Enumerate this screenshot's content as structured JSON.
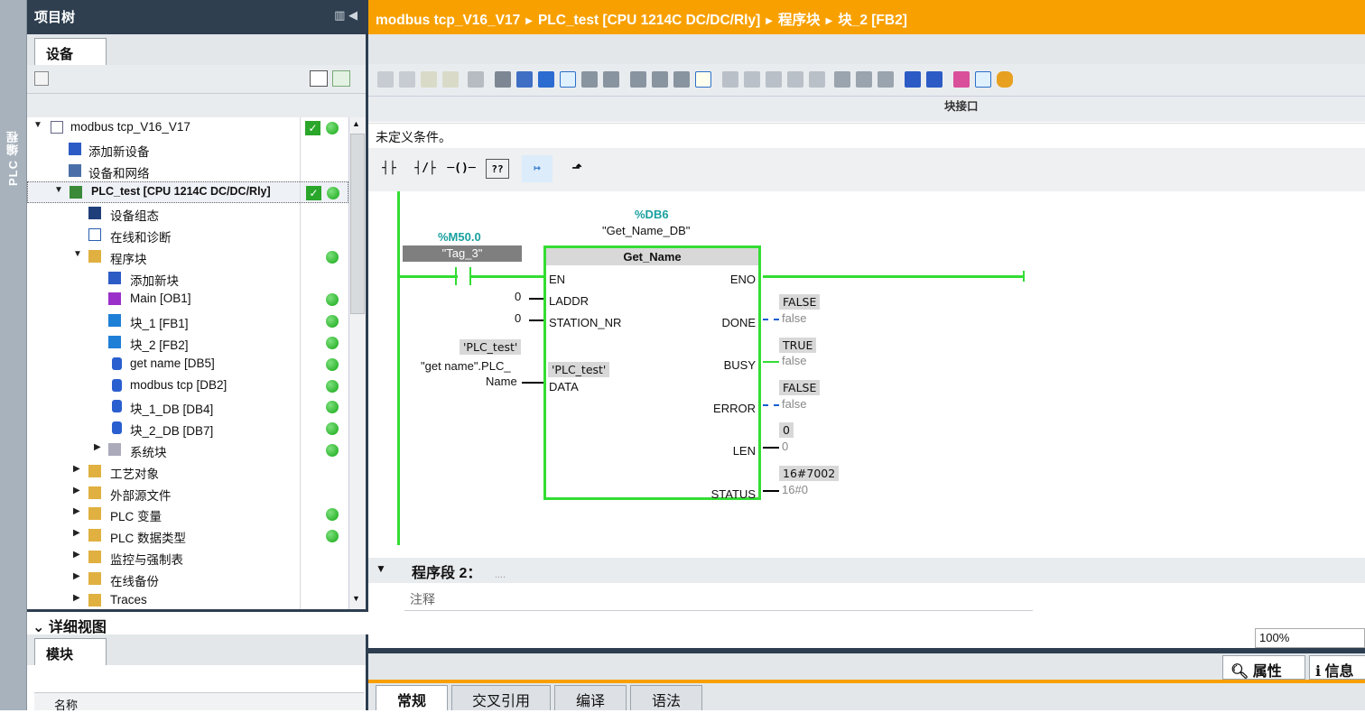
{
  "left_strip": {
    "label": "PLC 编程"
  },
  "tree": {
    "title": "项目树",
    "tab": "设备",
    "items": [
      {
        "label": "modbus tcp_V16_V17",
        "check": true,
        "dot": true
      },
      {
        "label": "添加新设备"
      },
      {
        "label": "设备和网络"
      },
      {
        "label": "PLC_test [CPU 1214C DC/DC/Rly]",
        "check": true,
        "dot": true
      },
      {
        "label": "设备组态"
      },
      {
        "label": "在线和诊断"
      },
      {
        "label": "程序块",
        "dot": true
      },
      {
        "label": "添加新块"
      },
      {
        "label": "Main [OB1]",
        "dot": true
      },
      {
        "label": "块_1 [FB1]",
        "dot": true
      },
      {
        "label": "块_2 [FB2]",
        "dot": true
      },
      {
        "label": "get name [DB5]",
        "dot": true
      },
      {
        "label": "modbus tcp [DB2]",
        "dot": true
      },
      {
        "label": "块_1_DB [DB4]",
        "dot": true
      },
      {
        "label": "块_2_DB [DB7]",
        "dot": true
      },
      {
        "label": "系统块",
        "dot": true
      },
      {
        "label": "工艺对象"
      },
      {
        "label": "外部源文件"
      },
      {
        "label": "PLC 变量",
        "dot": true
      },
      {
        "label": "PLC 数据类型",
        "dot": true
      },
      {
        "label": "监控与强制表"
      },
      {
        "label": "在线备份"
      },
      {
        "label": "Traces"
      }
    ]
  },
  "detail": {
    "title": "详细视图",
    "tab": "模块",
    "col_name": "名称"
  },
  "breadcrumb": {
    "parts": [
      "modbus tcp_V16_V17",
      "PLC_test [CPU 1214C DC/DC/Rly]",
      "程序块",
      "块_2 [FB2]"
    ]
  },
  "editor": {
    "interface_label": "块接口",
    "condition_text": "未定义条件。",
    "segment2_title": "程序段 2：",
    "segment2_dots": "....",
    "comment_placeholder": "注释",
    "zoom": "100%"
  },
  "ladder": {
    "contact_address": "%M50.0",
    "contact_tag": "\"Tag_3\"",
    "db_address": "%DB6",
    "db_name": "\"Get_Name_DB\"",
    "block_name": "Get_Name",
    "pins_left": [
      "EN",
      "LADDR",
      "STATION_NR",
      "DATA"
    ],
    "pins_right": [
      "ENO",
      "DONE",
      "BUSY",
      "ERROR",
      "LEN",
      "STATUS"
    ],
    "laddr_value": "0",
    "station_value": "0",
    "data_watch": "'PLC_test'",
    "data_operand_line1": "\"get name\".PLC_",
    "data_operand_line2": "Name",
    "data_inner_value": "'PLC_test'",
    "done_watch": "FALSE",
    "done_operand": "false",
    "busy_watch": "TRUE",
    "busy_operand": "false",
    "error_watch": "FALSE",
    "error_operand": "false",
    "len_watch": "0",
    "len_operand": "0",
    "status_watch": "16#7002",
    "status_operand": "16#0"
  },
  "bottom": {
    "tabs": [
      "常规",
      "交叉引用",
      "编译",
      "语法"
    ],
    "properties": "属性",
    "info": "信息"
  },
  "colors": {
    "accent": "#f8a000",
    "dark": "#2f3f50",
    "energized": "#33dd33"
  }
}
